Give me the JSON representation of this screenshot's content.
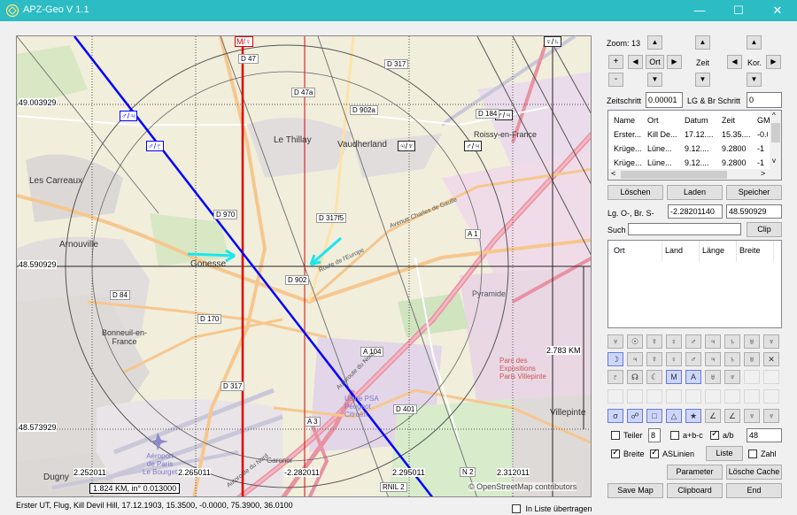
{
  "window": {
    "title": "APZ-Geo V 1.1",
    "controls": [
      "—",
      "☐",
      "✕"
    ]
  },
  "map": {
    "lat_labels": [
      "49.003929",
      "48.590929",
      "48.573929"
    ],
    "lon_labels": [
      "2.252011",
      "2.265011",
      "-2.282011",
      "2.295011",
      "2.312011"
    ],
    "scale_text": "1.824 KM, in° 0.013000",
    "distance_label": "2.783 KM",
    "attribution": "© OpenStreetMap contributors",
    "planet_markers": [
      "M/♀",
      "♀/♄",
      "♂/♃",
      "♂/♇",
      "♃/♆",
      "♂/♃",
      "♂/♃",
      "♆/♀"
    ],
    "places": [
      "Les Carreaux",
      "Le Thillay",
      "Vaudherland",
      "Roissy-en-France",
      "Arnouville",
      "Gonesse",
      "Bonneuil-en-\nFrance",
      "Pyramide",
      "Parc des\nExpositions\nParis Villepinte",
      "Villepinte",
      "Aéroport\nde Paris\nLe Bourget",
      "Usine PSA\nPeugeot\nCitroën",
      "Garonor",
      "Dugny"
    ],
    "roads": [
      "D 47",
      "D 317",
      "D 47a",
      "D 902a",
      "D 184",
      "D 970",
      "D 317f5",
      "A 1",
      "D 902",
      "D 84",
      "D 170",
      "D 317",
      "A 104",
      "D 401",
      "A 3",
      "N 2",
      "RNIL 2",
      "Avenue Charles de Gaulle",
      "Route de l'Europe",
      "Autoroute du Nord",
      "Autoroute du Nord"
    ]
  },
  "status": {
    "text": "Erster UT, Flug, Kill Devil Hill, 17.12.1903, 15.3500, -0.0000, 75.3900, 36.0100",
    "list_label": "In Liste übertragen",
    "list_checked": false
  },
  "controls": {
    "zoom_label": "Zoom: 13",
    "ort_label": "Ort",
    "zeit_label": "Zeit",
    "kor_label": "Kor.",
    "plus": "+",
    "minus": "-",
    "up": "▲",
    "down": "▼",
    "left": "◀",
    "right": "▶",
    "zeitschritt_label": "Zeitschritt",
    "zeitschritt_value": "0.00001",
    "lgbr_label": "LG & Br Schritt",
    "lgbr_value": "0"
  },
  "table1": {
    "headers": [
      "Name",
      "Ort",
      "Datum",
      "Zeit",
      "GM"
    ],
    "rows": [
      [
        "Erster...",
        "Kill De...",
        "17.12....",
        "15.35....",
        "-0.0"
      ],
      [
        "Krüge...",
        "Lüne...",
        "9.12....",
        "9.2800",
        "-1"
      ],
      [
        "Krüge...",
        "Lüne...",
        "9.12....",
        "9.2800",
        "-1"
      ]
    ]
  },
  "buttons": {
    "loeschen": "Löschen",
    "laden": "Laden",
    "speicher": "Speicher",
    "clip": "Clip",
    "parameter": "Parameter",
    "loesche_cache": "Lösche Cache",
    "save_map": "Save Map",
    "clipboard": "Clipboard",
    "end": "End",
    "liste": "Liste"
  },
  "coords": {
    "label": "Lg. O-, Br. S-",
    "lon_value": "-2.28201140⁠",
    "lat_value": "48.590929"
  },
  "search": {
    "label": "Such",
    "value": ""
  },
  "table2": {
    "headers": [
      "Ort",
      "Land",
      "Länge",
      "Breite"
    ]
  },
  "symbols": {
    "row1": [
      "♆",
      "☉",
      "☿",
      "♀",
      "♂",
      "♃",
      "♄",
      "♅",
      "♆"
    ],
    "row2": [
      "☽",
      "♃",
      "☿",
      "♀",
      "♂",
      "♃",
      "♄",
      "♅",
      "✕"
    ],
    "row3": [
      "♇",
      "☊",
      "☾",
      "M",
      "A",
      "♅",
      "♆",
      "",
      ""
    ],
    "row4": [
      "",
      "",
      "",
      "",
      "",
      "",
      "",
      "",
      ""
    ],
    "row5": [
      "σ",
      "☍",
      "□",
      "△",
      "★",
      "∠",
      "∠",
      "♆",
      "♆"
    ]
  },
  "options": {
    "teiler_label": "Teiler",
    "teiler_value": "8",
    "abc_label": "a+b-c",
    "ab_label": "a/b",
    "ab_value": "48",
    "breite_label": "Breite",
    "aslinien_label": "ASLinien",
    "zahl_label": "Zahl"
  },
  "colors": {
    "titlebar": "#2bbcc4",
    "blue_line": "#0000ff",
    "red_line": "#e00000",
    "arrow": "#19e6ef"
  }
}
